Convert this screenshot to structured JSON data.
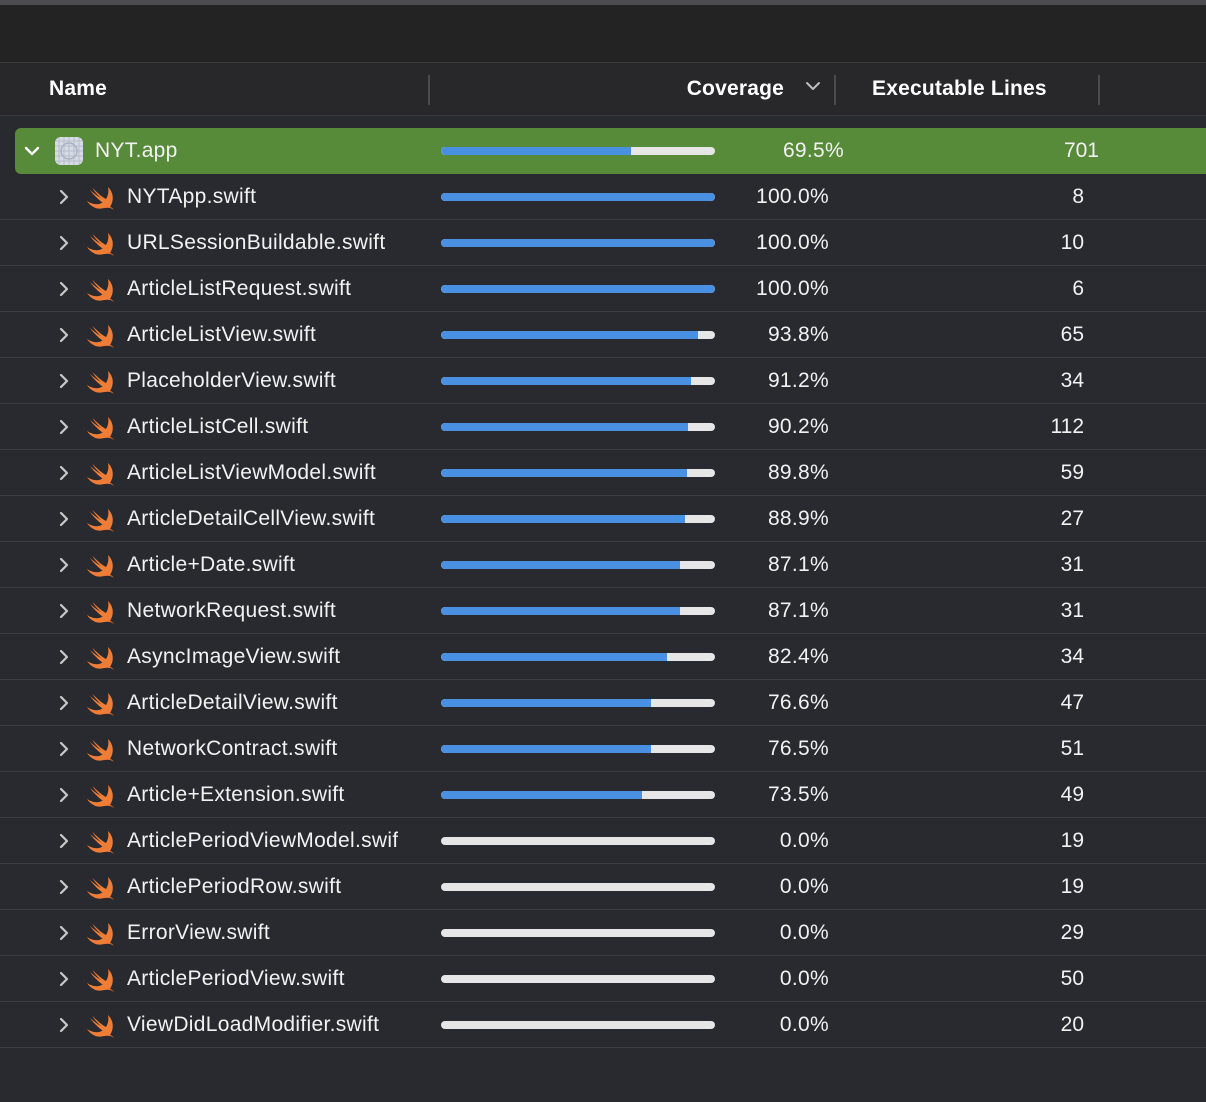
{
  "colors": {
    "accent_bar": "#4a90e2",
    "selected_row": "#578a39",
    "background": "#292a30",
    "bar_track": "#e6e6e6"
  },
  "columns": {
    "name": "Name",
    "coverage": "Coverage",
    "executable_lines": "Executable Lines"
  },
  "target": {
    "icon": "app-icon",
    "name": "NYT.app",
    "coverage_label": "69.5%",
    "coverage": 0.695,
    "lines": "701"
  },
  "files": [
    {
      "icon": "swift-icon",
      "name": "NYTApp.swift",
      "coverage_label": "100.0%",
      "coverage": 1.0,
      "lines": "8"
    },
    {
      "icon": "swift-icon",
      "name": "URLSessionBuildable.swift",
      "coverage_label": "100.0%",
      "coverage": 1.0,
      "lines": "10"
    },
    {
      "icon": "swift-icon",
      "name": "ArticleListRequest.swift",
      "coverage_label": "100.0%",
      "coverage": 1.0,
      "lines": "6"
    },
    {
      "icon": "swift-icon",
      "name": "ArticleListView.swift",
      "coverage_label": "93.8%",
      "coverage": 0.938,
      "lines": "65"
    },
    {
      "icon": "swift-icon",
      "name": "PlaceholderView.swift",
      "coverage_label": "91.2%",
      "coverage": 0.912,
      "lines": "34"
    },
    {
      "icon": "swift-icon",
      "name": "ArticleListCell.swift",
      "coverage_label": "90.2%",
      "coverage": 0.902,
      "lines": "112"
    },
    {
      "icon": "swift-icon",
      "name": "ArticleListViewModel.swift",
      "coverage_label": "89.8%",
      "coverage": 0.898,
      "lines": "59"
    },
    {
      "icon": "swift-icon",
      "name": "ArticleDetailCellView.swift",
      "coverage_label": "88.9%",
      "coverage": 0.889,
      "lines": "27"
    },
    {
      "icon": "swift-icon",
      "name": "Article+Date.swift",
      "coverage_label": "87.1%",
      "coverage": 0.871,
      "lines": "31"
    },
    {
      "icon": "swift-icon",
      "name": "NetworkRequest.swift",
      "coverage_label": "87.1%",
      "coverage": 0.871,
      "lines": "31"
    },
    {
      "icon": "swift-icon",
      "name": "AsyncImageView.swift",
      "coverage_label": "82.4%",
      "coverage": 0.824,
      "lines": "34"
    },
    {
      "icon": "swift-icon",
      "name": "ArticleDetailView.swift",
      "coverage_label": "76.6%",
      "coverage": 0.766,
      "lines": "47"
    },
    {
      "icon": "swift-icon",
      "name": "NetworkContract.swift",
      "coverage_label": "76.5%",
      "coverage": 0.765,
      "lines": "51"
    },
    {
      "icon": "swift-icon",
      "name": "Article+Extension.swift",
      "coverage_label": "73.5%",
      "coverage": 0.735,
      "lines": "49"
    },
    {
      "icon": "swift-icon",
      "name": "ArticlePeriodViewModel.swif",
      "coverage_label": "0.0%",
      "coverage": 0.0,
      "lines": "19"
    },
    {
      "icon": "swift-icon",
      "name": "ArticlePeriodRow.swift",
      "coverage_label": "0.0%",
      "coverage": 0.0,
      "lines": "19"
    },
    {
      "icon": "swift-icon",
      "name": "ErrorView.swift",
      "coverage_label": "0.0%",
      "coverage": 0.0,
      "lines": "29"
    },
    {
      "icon": "swift-icon",
      "name": "ArticlePeriodView.swift",
      "coverage_label": "0.0%",
      "coverage": 0.0,
      "lines": "50"
    },
    {
      "icon": "swift-icon",
      "name": "ViewDidLoadModifier.swift",
      "coverage_label": "0.0%",
      "coverage": 0.0,
      "lines": "20"
    }
  ]
}
